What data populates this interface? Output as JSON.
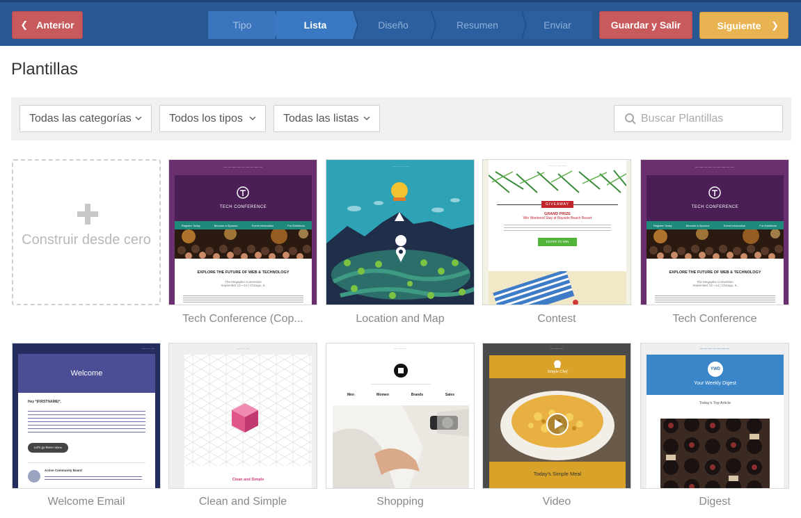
{
  "nav": {
    "prev_label": "Anterior",
    "save_label": "Guardar y Salir",
    "next_label": "Siguiente",
    "steps": [
      "Tipo",
      "Lista",
      "Diseño",
      "Resumen",
      "Enviar"
    ],
    "active_step": "Lista"
  },
  "page": {
    "title": "Plantillas"
  },
  "filters": {
    "categories": "Todas las categorías",
    "types": "Todos los tipos",
    "lists": "Todas las listas",
    "search_placeholder": "Buscar Plantillas"
  },
  "scratch": {
    "label": "Construir desde cero"
  },
  "templates": [
    {
      "name": "Tech Conference (Cop...",
      "header": "TECH CONFERENCE",
      "links": [
        "Register Today",
        "Become a Sponsor",
        "Event Information",
        "For Exhibitors"
      ],
      "headline": "EXPLORE THE FUTURE OF WEB & TECHNOLOGY",
      "sub": "The Megaplex Convention",
      "date": "September 12—14 | Chicago, IL"
    },
    {
      "name": "Location and Map"
    },
    {
      "name": "Contest",
      "badge": "GIVEAWAY",
      "prize": "GRAND PRIZE",
      "prize_sub": "Win Weekend Stay at Bayside Beach Resort",
      "cta": "ENTER TO WIN"
    },
    {
      "name": "Tech Conference",
      "header": "TECH CONFERENCE",
      "links": [
        "Register Today",
        "Become a Sponsor",
        "Event Information",
        "For Exhibitors"
      ],
      "headline": "EXPLORE THE FUTURE OF WEB & TECHNOLOGY",
      "sub": "The Megaplex Convention",
      "date": "September 12—14 | Chicago, IL"
    },
    {
      "name": "Welcome Email",
      "header": "Welcome",
      "greeting": "Hey *|FIRSTNAME|*,",
      "cta": "Let's go there now ▸",
      "footer_title": "Active Community Board"
    },
    {
      "name": "Clean and Simple",
      "title": "Clean and Simple"
    },
    {
      "name": "Shopping",
      "menu": [
        "Men",
        "Women",
        "Brands",
        "Sales"
      ]
    },
    {
      "name": "Video",
      "brand": "Simple Chef",
      "title": "Today's Simple Meal"
    },
    {
      "name": "Digest",
      "badge": "YWD",
      "title": "Your Weekly Digest",
      "article": "Today's Top Article"
    }
  ]
}
